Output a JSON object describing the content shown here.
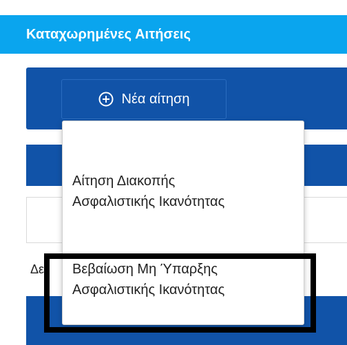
{
  "header": {
    "title": "Καταχωρημένες Αιτήσεις"
  },
  "toolbar": {
    "new_request_label": "Νέα αίτηση",
    "new_request_icon": "plus-circle-icon"
  },
  "table": {
    "row_text_fragment": "Δε"
  },
  "dropdown": {
    "items": [
      {
        "label_line1": "Αίτηση Διακοπής",
        "label_line2": "Ασφαλιστικής Ικανότητας"
      },
      {
        "label_line1": "Βεβαίωση Μη Ύπαρξης",
        "label_line2": "Ασφαλιστικής Ικανότητας"
      }
    ]
  },
  "colors": {
    "header_bg": "#0aa5ee",
    "panel_bg": "#1153a8",
    "highlight_border": "#000000"
  }
}
